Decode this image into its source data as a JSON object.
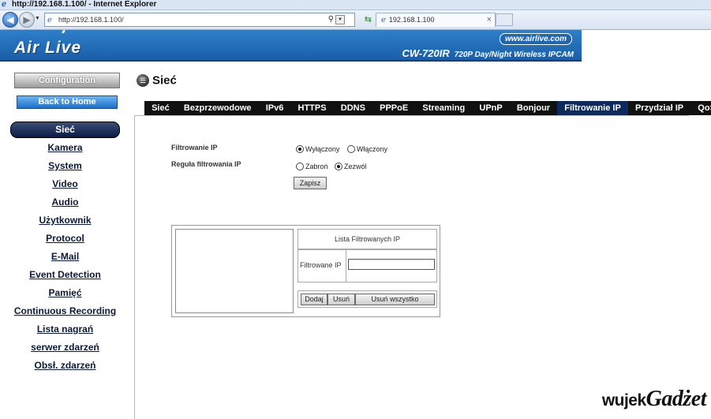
{
  "browser": {
    "window_title": "http://192.168.1.100/ - Internet Explorer",
    "address": "http://192.168.1.100/",
    "tab_title": "192.168.1.100"
  },
  "header": {
    "logo": "Air Live",
    "url_pill": "www.airlive.com",
    "model": "CW-720IR",
    "model_desc": "720P Day/Night Wireless IPCAM"
  },
  "sidebar": {
    "configuration": "Configuration",
    "back_home": "Back to Home",
    "active_item": "Sieć",
    "items": [
      "Kamera",
      "System",
      "Video",
      "Audio",
      "Użytkownik",
      "Protocol",
      "E-Mail",
      "Event Detection",
      "Pamięć",
      "Continuous Recording",
      "Lista nagrań",
      "serwer zdarzeń",
      "Obsł. zdarzeń"
    ]
  },
  "page": {
    "title": "Sieć",
    "tabs": [
      "Sieć",
      "Bezprzewodowe",
      "IPv6",
      "HTTPS",
      "DDNS",
      "PPPoE",
      "Streaming",
      "UPnP",
      "Bonjour",
      "Filtrowanie IP",
      "Przydział IP",
      "QoS"
    ],
    "active_tab": "Filtrowanie IP"
  },
  "form": {
    "ip_filter_label": "Filtrowanie IP",
    "ip_filter_options": [
      "Wyłączony",
      "Włączony"
    ],
    "ip_filter_selected": "Wyłączony",
    "rule_label": "Reguła filtrowania IP",
    "rule_options": [
      "Zabroń",
      "Zezwól"
    ],
    "rule_selected": "Zezwól",
    "save": "Zapisz",
    "list_title": "Lista Filtrowanych IP",
    "filtered_ip_label": "Filtrowane IP",
    "filtered_ip_value": "",
    "add": "Dodaj",
    "remove": "Usuń",
    "remove_all": "Usuń wszystko"
  },
  "watermark": {
    "text1": "wujek",
    "text2": "Gadżet"
  }
}
